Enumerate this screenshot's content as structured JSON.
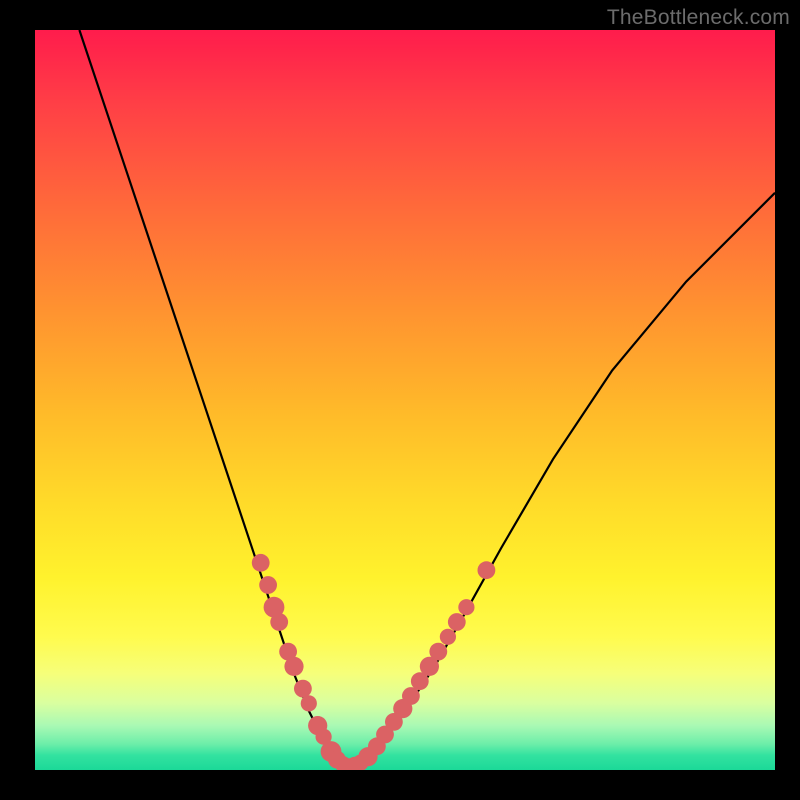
{
  "watermark": "TheBottleneck.com",
  "colors": {
    "background": "#000000",
    "gradient_top": "#ff1c4c",
    "gradient_bottom": "#1bd998",
    "curve": "#000000",
    "dots": "#db6264"
  },
  "chart_data": {
    "type": "line",
    "title": "",
    "xlabel": "",
    "ylabel": "",
    "xlim": [
      0,
      100
    ],
    "ylim": [
      0,
      100
    ],
    "series": [
      {
        "name": "bottleneck-curve",
        "x": [
          6,
          10,
          14,
          18,
          22,
          26,
          30,
          33,
          35,
          37,
          39,
          40,
          41,
          42,
          43,
          44,
          45,
          47,
          50,
          54,
          58,
          63,
          70,
          78,
          88,
          100
        ],
        "y": [
          100,
          88,
          76,
          64,
          52,
          40,
          28,
          19,
          13,
          8,
          4,
          2,
          1,
          0.5,
          0.7,
          1,
          2,
          4,
          8,
          14,
          21,
          30,
          42,
          54,
          66,
          78
        ]
      }
    ],
    "scatter": [
      {
        "name": "curve-dots",
        "points": [
          {
            "x": 30.5,
            "y": 28,
            "r": 1.2
          },
          {
            "x": 31.5,
            "y": 25,
            "r": 1.2
          },
          {
            "x": 32.3,
            "y": 22,
            "r": 1.4
          },
          {
            "x": 33.0,
            "y": 20,
            "r": 1.2
          },
          {
            "x": 34.2,
            "y": 16,
            "r": 1.2
          },
          {
            "x": 35.0,
            "y": 14,
            "r": 1.3
          },
          {
            "x": 36.2,
            "y": 11,
            "r": 1.2
          },
          {
            "x": 37.0,
            "y": 9,
            "r": 1.1
          },
          {
            "x": 38.2,
            "y": 6,
            "r": 1.3
          },
          {
            "x": 39.0,
            "y": 4.5,
            "r": 1.1
          },
          {
            "x": 40.0,
            "y": 2.5,
            "r": 1.4
          },
          {
            "x": 40.8,
            "y": 1.4,
            "r": 1.2
          },
          {
            "x": 41.6,
            "y": 0.8,
            "r": 1.1
          },
          {
            "x": 42.4,
            "y": 0.5,
            "r": 1.1
          },
          {
            "x": 43.2,
            "y": 0.7,
            "r": 1.1
          },
          {
            "x": 44.0,
            "y": 1.0,
            "r": 1.1
          },
          {
            "x": 45.0,
            "y": 1.8,
            "r": 1.3
          },
          {
            "x": 46.2,
            "y": 3.2,
            "r": 1.2
          },
          {
            "x": 47.3,
            "y": 4.8,
            "r": 1.2
          },
          {
            "x": 48.5,
            "y": 6.5,
            "r": 1.2
          },
          {
            "x": 49.7,
            "y": 8.3,
            "r": 1.3
          },
          {
            "x": 50.8,
            "y": 10,
            "r": 1.2
          },
          {
            "x": 52.0,
            "y": 12,
            "r": 1.2
          },
          {
            "x": 53.3,
            "y": 14,
            "r": 1.3
          },
          {
            "x": 54.5,
            "y": 16,
            "r": 1.2
          },
          {
            "x": 55.8,
            "y": 18,
            "r": 1.1
          },
          {
            "x": 57.0,
            "y": 20,
            "r": 1.2
          },
          {
            "x": 58.3,
            "y": 22,
            "r": 1.1
          },
          {
            "x": 61.0,
            "y": 27,
            "r": 1.2
          }
        ]
      }
    ]
  }
}
